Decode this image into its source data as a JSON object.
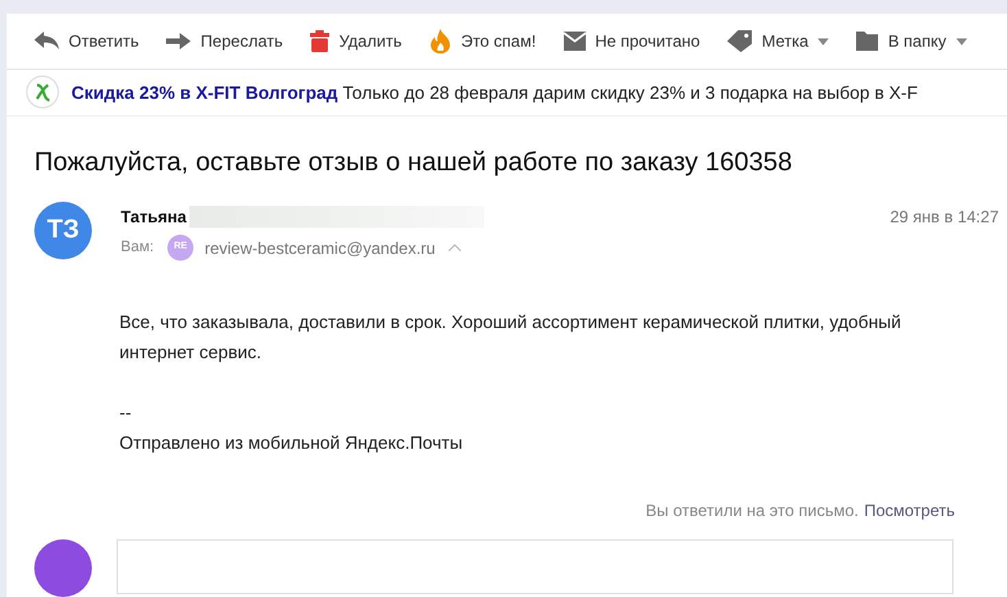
{
  "toolbar": [
    {
      "kind": "reply",
      "label": "Ответить",
      "dropdown": false
    },
    {
      "kind": "forward",
      "label": "Переслать",
      "dropdown": false
    },
    {
      "kind": "delete",
      "label": "Удалить",
      "dropdown": false
    },
    {
      "kind": "spam",
      "label": "Это спам!",
      "dropdown": false
    },
    {
      "kind": "unread",
      "label": "Не прочитано",
      "dropdown": false
    },
    {
      "kind": "label",
      "label": "Метка",
      "dropdown": true
    },
    {
      "kind": "folder",
      "label": "В папку",
      "dropdown": true
    }
  ],
  "promo": {
    "title": "Скидка 23% в X-FIT Волгоград",
    "text": "Только до 28 февраля дарим скидку 23% и 3 подарка на выбор в X-F"
  },
  "subject": "Пожалуйста, оставьте отзыв о нашей работе по заказу 160358",
  "message": {
    "avatar": "ТЗ",
    "sender": "Татьяна",
    "date": "29 янв в 14:27",
    "to_label": "Вам:",
    "recipient_avatar": "RE",
    "recipient": "review-bestceramic@yandex.ru",
    "body": [
      "Все, что заказывала, доставили в срок. Хороший ассортимент керамической плитки, удобный интернет сервис."
    ],
    "signature": [
      "--",
      "Отправлено из мобильной Яндекс.Почты"
    ]
  },
  "reply_note": {
    "text": "Вы ответили на это письмо.",
    "link": "Посмотреть"
  }
}
